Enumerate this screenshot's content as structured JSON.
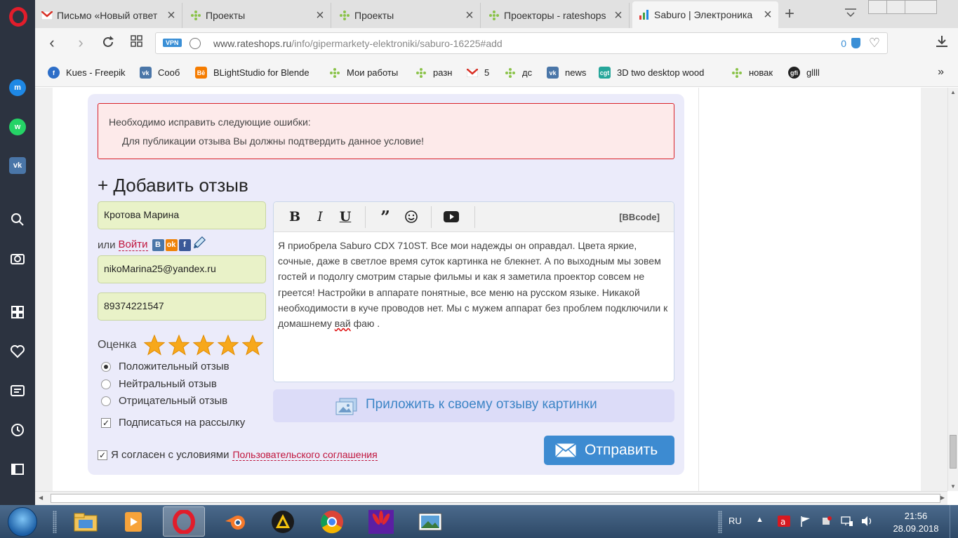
{
  "browser": {
    "tabs": [
      {
        "title": "Письмо «Новый ответ",
        "icon": "gmail-icon"
      },
      {
        "title": "Проекты",
        "icon": "project-icon"
      },
      {
        "title": "Проекты",
        "icon": "project-icon"
      },
      {
        "title": "Проекторы - rateshops",
        "icon": "project-icon"
      },
      {
        "title": "Saburo | Электроника",
        "icon": "chart-icon",
        "active": true
      }
    ],
    "url": {
      "vpn": "VPN",
      "host": "www.rateshops.ru",
      "path": "/info/gipermarkety-elektroniki/saburo-16225#add",
      "counter": "0"
    },
    "bookmarks": [
      {
        "label": "Kues - Freepik",
        "icon": "freepik-icon"
      },
      {
        "label": "Сооб",
        "icon": "vk-icon"
      },
      {
        "label": "BLightStudio for Blende",
        "icon": "behance-icon"
      },
      {
        "label": "Мои работы",
        "icon": "project-icon"
      },
      {
        "label": "разн",
        "icon": "project-icon"
      },
      {
        "label": "5",
        "icon": "gmail-icon"
      },
      {
        "label": "дс",
        "icon": "project-icon"
      },
      {
        "label": "news",
        "icon": "vk-icon"
      },
      {
        "label": "3D two desktop wood",
        "icon": "cgt-icon"
      },
      {
        "label": "новак",
        "icon": "project-icon"
      },
      {
        "label": "gllll",
        "icon": "gfi-icon"
      }
    ]
  },
  "form": {
    "error_title": "Необходимо исправить следующие ошибки:",
    "error_message": "Для публикации отзыва Вы должны подтвердить данное условие!",
    "heading": "+ Добавить отзыв",
    "name_value": "Кротова Марина",
    "or_label": "или",
    "login_link": "Войти",
    "email_value": "nikoMarina25@yandex.ru",
    "phone_value": "89374221547",
    "rating_label": "Оценка",
    "rating": 5,
    "review_types": [
      {
        "label": "Положительный отзыв",
        "checked": true
      },
      {
        "label": "Нейтральный отзыв",
        "checked": false
      },
      {
        "label": "Отрицательный отзыв",
        "checked": false
      }
    ],
    "subscribe_label": "Подписаться на рассылку",
    "subscribe_checked": true,
    "agree_label": "Я согласен с условиями",
    "agree_link": "Пользовательского соглашения",
    "agree_checked": true,
    "editor": {
      "bold": "B",
      "italic": "I",
      "underline": "U",
      "bbcode": "[BBcode]",
      "text_before": "Я приобрела Saburo CDX 710ST. Все мои надежды он оправдал. Цвета яркие, сочные, даже в светлое время суток картинка не блекнет.  А по выходным мы зовем гостей и подолгу смотрим старые фильмы и как я заметила проектор совсем не греется!  Настройки в аппарате понятные, все меню на русском языке. Никакой необходимости в куче проводов нет. Мы с мужем аппарат без проблем подключили к домашнему ",
      "text_misspelled": "вай",
      "text_after": " фаю ."
    },
    "attach_label": "Приложить к своему отзыву картинки",
    "submit_label": "Отправить"
  },
  "taskbar": {
    "lang": "RU",
    "time": "21:56",
    "date": "28.09.2018"
  }
}
